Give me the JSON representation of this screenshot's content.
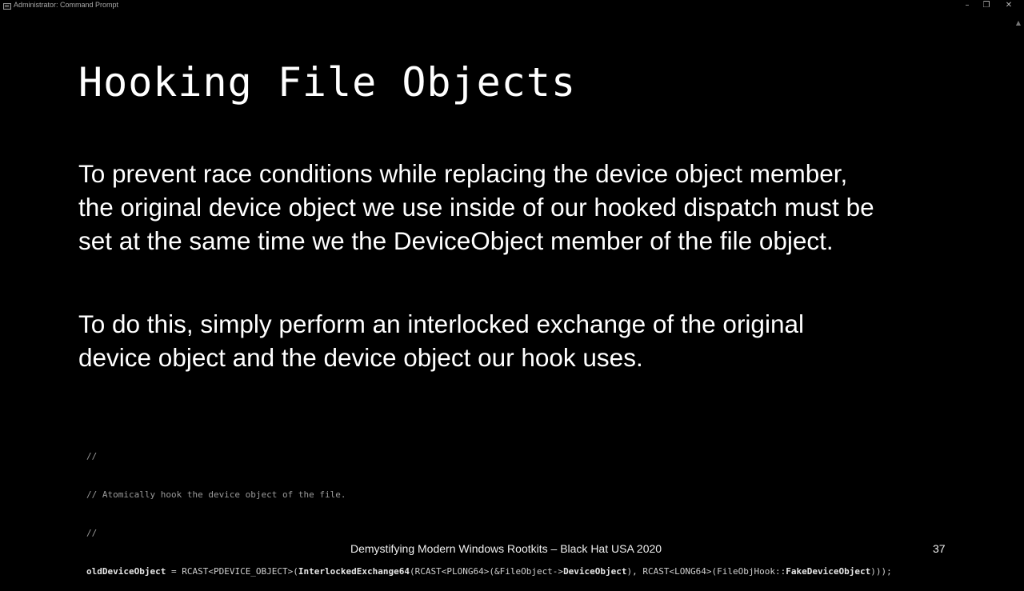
{
  "window": {
    "title": "Administrator: Command Prompt",
    "icon": "command-prompt-icon",
    "controls": {
      "minimize": "–",
      "maximize": "❐",
      "close": "✕"
    },
    "scroll_up": "▲"
  },
  "slide": {
    "title": "Hooking File Objects",
    "paragraph1": [
      "To prevent race conditions while replacing the device object member,",
      "the original device object we use inside of our hooked dispatch must be",
      "set at the same time we the DeviceObject member of the file object."
    ],
    "paragraph2": [
      "To do this, simply perform an interlocked exchange of the original",
      "device object and the device object our hook uses."
    ],
    "code": {
      "comment_lines": [
        "//",
        "// Atomically hook the device object of the file.",
        "//"
      ],
      "statement": {
        "var": "oldDeviceObject",
        "op": " = ",
        "cast1": "RCAST<PDEVICE_OBJECT>(",
        "func": "InterlockedExchange64",
        "cast2": "(RCAST<PLONG64>(&FileObject->",
        "member": "DeviceObject",
        "cast3": "), RCAST<LONG64>(FileObjHook::",
        "member2": "FakeDeviceObject",
        "end": ")));"
      }
    },
    "footer": "Demystifying Modern Windows Rootkits – Black Hat USA 2020",
    "page_number": "37"
  },
  "colors": {
    "background": "#000000",
    "text": "#ffffff",
    "code": "#cfcfcf",
    "comment": "#9a9a9a"
  }
}
